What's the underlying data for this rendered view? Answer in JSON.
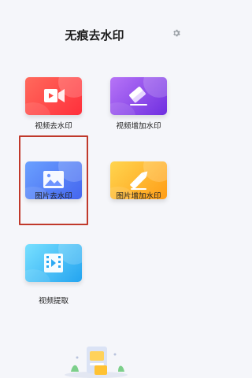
{
  "header": {
    "title": "无痕去水印",
    "settings_icon": "gear-icon"
  },
  "features": [
    {
      "label": "视频去水印",
      "icon": "video-camera-icon",
      "color_from": "#ff5a5f",
      "color_to": "#ff3a2e"
    },
    {
      "label": "视频增加水印",
      "icon": "eraser-icon",
      "color_from": "#b06cf5",
      "color_to": "#7a37e0"
    },
    {
      "label": "图片去水印",
      "icon": "image-icon",
      "color_from": "#5b93ff",
      "color_to": "#4a6ef0"
    },
    {
      "label": "图片增加水印",
      "icon": "pencil-icon",
      "color_from": "#ffd24d",
      "color_to": "#ffa11a"
    },
    {
      "label": "视频提取",
      "icon": "film-icon",
      "color_from": "#6ad8ff",
      "color_to": "#2aa8f2"
    }
  ],
  "selection_color": "#c0392b"
}
